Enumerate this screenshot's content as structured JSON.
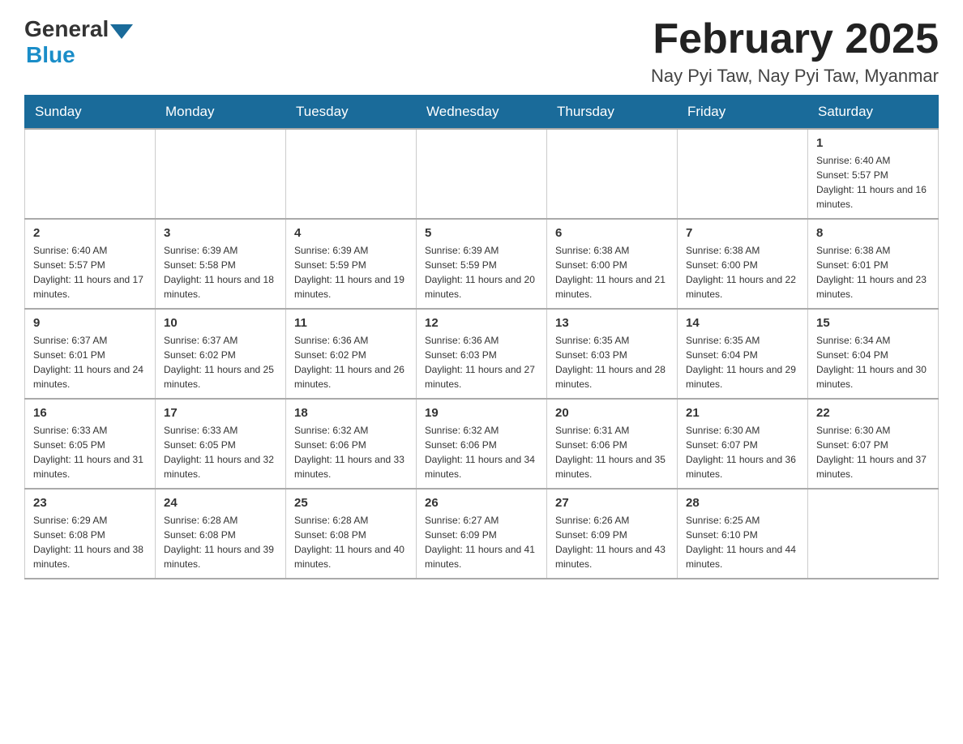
{
  "logo": {
    "general": "General",
    "blue": "Blue"
  },
  "title": "February 2025",
  "subtitle": "Nay Pyi Taw, Nay Pyi Taw, Myanmar",
  "days_of_week": [
    "Sunday",
    "Monday",
    "Tuesday",
    "Wednesday",
    "Thursday",
    "Friday",
    "Saturday"
  ],
  "weeks": [
    [
      {
        "day": "",
        "info": ""
      },
      {
        "day": "",
        "info": ""
      },
      {
        "day": "",
        "info": ""
      },
      {
        "day": "",
        "info": ""
      },
      {
        "day": "",
        "info": ""
      },
      {
        "day": "",
        "info": ""
      },
      {
        "day": "1",
        "info": "Sunrise: 6:40 AM\nSunset: 5:57 PM\nDaylight: 11 hours and 16 minutes."
      }
    ],
    [
      {
        "day": "2",
        "info": "Sunrise: 6:40 AM\nSunset: 5:57 PM\nDaylight: 11 hours and 17 minutes."
      },
      {
        "day": "3",
        "info": "Sunrise: 6:39 AM\nSunset: 5:58 PM\nDaylight: 11 hours and 18 minutes."
      },
      {
        "day": "4",
        "info": "Sunrise: 6:39 AM\nSunset: 5:59 PM\nDaylight: 11 hours and 19 minutes."
      },
      {
        "day": "5",
        "info": "Sunrise: 6:39 AM\nSunset: 5:59 PM\nDaylight: 11 hours and 20 minutes."
      },
      {
        "day": "6",
        "info": "Sunrise: 6:38 AM\nSunset: 6:00 PM\nDaylight: 11 hours and 21 minutes."
      },
      {
        "day": "7",
        "info": "Sunrise: 6:38 AM\nSunset: 6:00 PM\nDaylight: 11 hours and 22 minutes."
      },
      {
        "day": "8",
        "info": "Sunrise: 6:38 AM\nSunset: 6:01 PM\nDaylight: 11 hours and 23 minutes."
      }
    ],
    [
      {
        "day": "9",
        "info": "Sunrise: 6:37 AM\nSunset: 6:01 PM\nDaylight: 11 hours and 24 minutes."
      },
      {
        "day": "10",
        "info": "Sunrise: 6:37 AM\nSunset: 6:02 PM\nDaylight: 11 hours and 25 minutes."
      },
      {
        "day": "11",
        "info": "Sunrise: 6:36 AM\nSunset: 6:02 PM\nDaylight: 11 hours and 26 minutes."
      },
      {
        "day": "12",
        "info": "Sunrise: 6:36 AM\nSunset: 6:03 PM\nDaylight: 11 hours and 27 minutes."
      },
      {
        "day": "13",
        "info": "Sunrise: 6:35 AM\nSunset: 6:03 PM\nDaylight: 11 hours and 28 minutes."
      },
      {
        "day": "14",
        "info": "Sunrise: 6:35 AM\nSunset: 6:04 PM\nDaylight: 11 hours and 29 minutes."
      },
      {
        "day": "15",
        "info": "Sunrise: 6:34 AM\nSunset: 6:04 PM\nDaylight: 11 hours and 30 minutes."
      }
    ],
    [
      {
        "day": "16",
        "info": "Sunrise: 6:33 AM\nSunset: 6:05 PM\nDaylight: 11 hours and 31 minutes."
      },
      {
        "day": "17",
        "info": "Sunrise: 6:33 AM\nSunset: 6:05 PM\nDaylight: 11 hours and 32 minutes."
      },
      {
        "day": "18",
        "info": "Sunrise: 6:32 AM\nSunset: 6:06 PM\nDaylight: 11 hours and 33 minutes."
      },
      {
        "day": "19",
        "info": "Sunrise: 6:32 AM\nSunset: 6:06 PM\nDaylight: 11 hours and 34 minutes."
      },
      {
        "day": "20",
        "info": "Sunrise: 6:31 AM\nSunset: 6:06 PM\nDaylight: 11 hours and 35 minutes."
      },
      {
        "day": "21",
        "info": "Sunrise: 6:30 AM\nSunset: 6:07 PM\nDaylight: 11 hours and 36 minutes."
      },
      {
        "day": "22",
        "info": "Sunrise: 6:30 AM\nSunset: 6:07 PM\nDaylight: 11 hours and 37 minutes."
      }
    ],
    [
      {
        "day": "23",
        "info": "Sunrise: 6:29 AM\nSunset: 6:08 PM\nDaylight: 11 hours and 38 minutes."
      },
      {
        "day": "24",
        "info": "Sunrise: 6:28 AM\nSunset: 6:08 PM\nDaylight: 11 hours and 39 minutes."
      },
      {
        "day": "25",
        "info": "Sunrise: 6:28 AM\nSunset: 6:08 PM\nDaylight: 11 hours and 40 minutes."
      },
      {
        "day": "26",
        "info": "Sunrise: 6:27 AM\nSunset: 6:09 PM\nDaylight: 11 hours and 41 minutes."
      },
      {
        "day": "27",
        "info": "Sunrise: 6:26 AM\nSunset: 6:09 PM\nDaylight: 11 hours and 43 minutes."
      },
      {
        "day": "28",
        "info": "Sunrise: 6:25 AM\nSunset: 6:10 PM\nDaylight: 11 hours and 44 minutes."
      },
      {
        "day": "",
        "info": ""
      }
    ]
  ]
}
